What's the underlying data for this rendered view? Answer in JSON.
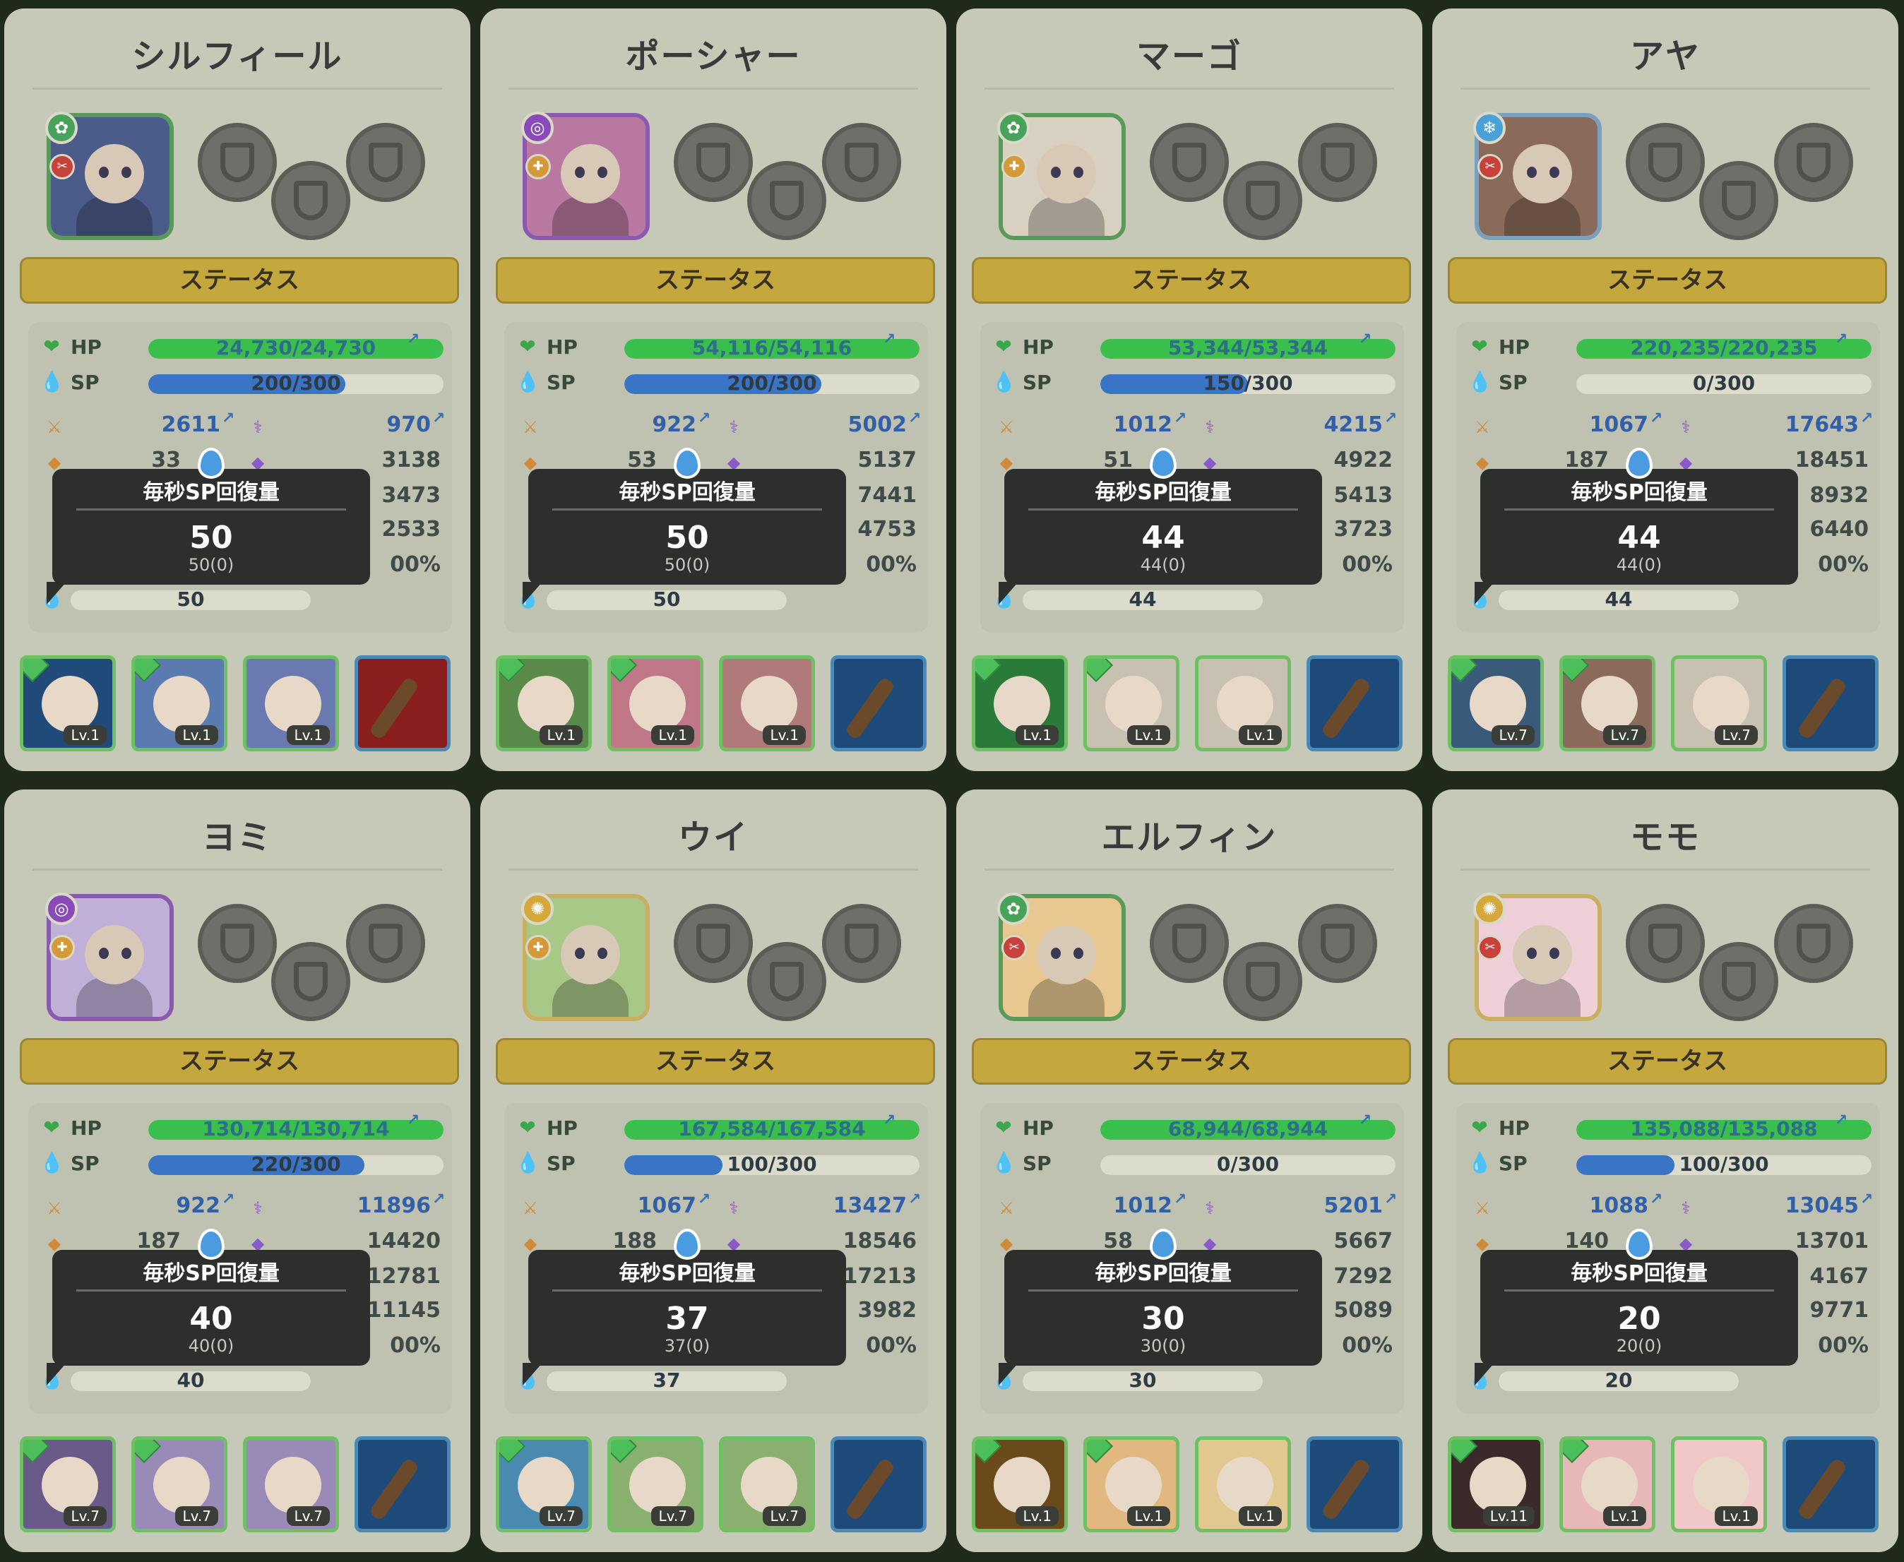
{
  "colors": {
    "hp_fill": "#3bbf4c",
    "sp_fill": "#3a74c4",
    "button": "#c4a73d",
    "card": "#c6c9b8",
    "tooltip": "#2d2f2c"
  },
  "tooltip_title": "毎秒SP回復量",
  "status_label": "ステータス",
  "hp_label": "HP",
  "sp_label": "SP",
  "characters": [
    {
      "name": "シルフィール",
      "element": "wind",
      "element_icon": "✿",
      "element_color": "#48a35a",
      "role_icon": "✂",
      "role_color": "#c8413a",
      "frame_color": "#5a9a58",
      "portrait_color": "#4b5b8a",
      "hp": "24,730/24,730",
      "hp_ratio": 1,
      "sp": "200/300",
      "sp_ratio": 0.667,
      "stat_atk": "2611",
      "stat_matk": "970",
      "stat_r2a": "33",
      "stat_r2b": "3138",
      "stat_r3b": "3473",
      "stat_r4b": "2533",
      "stat_r5b": "00%",
      "tt_value": "50",
      "tt_sub": "50(0)",
      "regen": "50",
      "skills": [
        {
          "lv": "Lv.1",
          "color": "#1f4a7a",
          "gem": true
        },
        {
          "lv": "Lv.1",
          "color": "#5b7bb0",
          "gem": true
        },
        {
          "lv": "Lv.1",
          "color": "#6a7ab0",
          "gem": false
        },
        {
          "lv": "",
          "color": "#8a1e1e",
          "gem": false
        }
      ]
    },
    {
      "name": "ポーシャー",
      "element": "dark",
      "element_icon": "◎",
      "element_color": "#8a4ab8",
      "role_icon": "✚",
      "role_color": "#d49a3a",
      "frame_color": "#8a5ab0",
      "portrait_color": "#b878a0",
      "hp": "54,116/54,116",
      "hp_ratio": 1,
      "sp": "200/300",
      "sp_ratio": 0.667,
      "stat_atk": "922",
      "stat_matk": "5002",
      "stat_r2a": "53",
      "stat_r2b": "5137",
      "stat_r3b": "7441",
      "stat_r4b": "4753",
      "stat_r5b": "00%",
      "tt_value": "50",
      "tt_sub": "50(0)",
      "regen": "50",
      "skills": [
        {
          "lv": "Lv.1",
          "color": "#5a8a4a",
          "gem": true
        },
        {
          "lv": "Lv.1",
          "color": "#c07888",
          "gem": true
        },
        {
          "lv": "Lv.1",
          "color": "#b07a7a",
          "gem": false
        },
        {
          "lv": "",
          "color": "#1e4a7a",
          "gem": false
        }
      ]
    },
    {
      "name": "マーゴ",
      "element": "wind",
      "element_icon": "✿",
      "element_color": "#48a35a",
      "role_icon": "✚",
      "role_color": "#d49a3a",
      "frame_color": "#5a9a58",
      "portrait_color": "#d8d0c0",
      "hp": "53,344/53,344",
      "hp_ratio": 1,
      "sp": "150/300",
      "sp_ratio": 0.5,
      "stat_atk": "1012",
      "stat_matk": "4215",
      "stat_r2a": "51",
      "stat_r2b": "4922",
      "stat_r3b": "5413",
      "stat_r4b": "3723",
      "stat_r5b": "00%",
      "tt_value": "44",
      "tt_sub": "44(0)",
      "regen": "44",
      "skills": [
        {
          "lv": "Lv.1",
          "color": "#2a7a3a",
          "gem": true
        },
        {
          "lv": "Lv.1",
          "color": "#c8c0b0",
          "gem": true
        },
        {
          "lv": "Lv.1",
          "color": "#c8c0b0",
          "gem": false
        },
        {
          "lv": "",
          "color": "#1e4a7a",
          "gem": false
        }
      ]
    },
    {
      "name": "アヤ",
      "element": "ice",
      "element_icon": "❄",
      "element_color": "#4aa0d8",
      "role_icon": "✂",
      "role_color": "#c8413a",
      "frame_color": "#7aa0c0",
      "portrait_color": "#8a6a5a",
      "hp": "220,235/220,235",
      "hp_ratio": 1,
      "sp": "0/300",
      "sp_ratio": 0,
      "stat_atk": "1067",
      "stat_matk": "17643",
      "stat_r2a": "187",
      "stat_r2b": "18451",
      "stat_r3b": "8932",
      "stat_r4b": "6440",
      "stat_r5b": "00%",
      "tt_value": "44",
      "tt_sub": "44(0)",
      "regen": "44",
      "skills": [
        {
          "lv": "Lv.7",
          "color": "#3a5a7a",
          "gem": true
        },
        {
          "lv": "Lv.7",
          "color": "#8a6a5a",
          "gem": true
        },
        {
          "lv": "Lv.7",
          "color": "#c8c0b0",
          "gem": false
        },
        {
          "lv": "",
          "color": "#1e4a7a",
          "gem": false
        }
      ]
    },
    {
      "name": "ヨミ",
      "element": "dark",
      "element_icon": "◎",
      "element_color": "#8a4ab8",
      "role_icon": "✚",
      "role_color": "#d49a3a",
      "frame_color": "#8a5ab0",
      "portrait_color": "#c0b0d8",
      "hp": "130,714/130,714",
      "hp_ratio": 1,
      "sp": "220/300",
      "sp_ratio": 0.733,
      "stat_atk": "922",
      "stat_matk": "11896",
      "stat_r2a": "187",
      "stat_r2b": "14420",
      "stat_r3b": "12781",
      "stat_r4b": "11145",
      "stat_r5b": "00%",
      "tt_value": "40",
      "tt_sub": "40(0)",
      "regen": "40",
      "skills": [
        {
          "lv": "Lv.7",
          "color": "#6a5a8a",
          "gem": true
        },
        {
          "lv": "Lv.7",
          "color": "#9a8ab8",
          "gem": true
        },
        {
          "lv": "Lv.7",
          "color": "#9a8ab8",
          "gem": false
        },
        {
          "lv": "",
          "color": "#1e4a7a",
          "gem": false
        }
      ]
    },
    {
      "name": "ウイ",
      "element": "light",
      "element_icon": "✺",
      "element_color": "#d4a83a",
      "role_icon": "✚",
      "role_color": "#d49a3a",
      "frame_color": "#c8b060",
      "portrait_color": "#a8c888",
      "hp": "167,584/167,584",
      "hp_ratio": 1,
      "sp": "100/300",
      "sp_ratio": 0.333,
      "stat_atk": "1067",
      "stat_matk": "13427",
      "stat_r2a": "188",
      "stat_r2b": "18546",
      "stat_r3b": "17213",
      "stat_r4b": "3982",
      "stat_r5b": "00%",
      "tt_value": "37",
      "tt_sub": "37(0)",
      "regen": "37",
      "skills": [
        {
          "lv": "Lv.7",
          "color": "#4a8ab0",
          "gem": true
        },
        {
          "lv": "Lv.7",
          "color": "#8ab070",
          "gem": true
        },
        {
          "lv": "Lv.7",
          "color": "#8ab070",
          "gem": false
        },
        {
          "lv": "",
          "color": "#1e4a7a",
          "gem": false
        }
      ]
    },
    {
      "name": "エルフィン",
      "element": "wind",
      "element_icon": "✿",
      "element_color": "#48a35a",
      "role_icon": "✂",
      "role_color": "#c8413a",
      "frame_color": "#5a9a58",
      "portrait_color": "#e8c890",
      "hp": "68,944/68,944",
      "hp_ratio": 1,
      "sp": "0/300",
      "sp_ratio": 0,
      "stat_atk": "1012",
      "stat_matk": "5201",
      "stat_r2a": "58",
      "stat_r2b": "5667",
      "stat_r3b": "7292",
      "stat_r4b": "5089",
      "stat_r5b": "00%",
      "tt_value": "30",
      "tt_sub": "30(0)",
      "regen": "30",
      "skills": [
        {
          "lv": "Lv.1",
          "color": "#6a4a1a",
          "gem": true
        },
        {
          "lv": "Lv.1",
          "color": "#e0b880",
          "gem": true
        },
        {
          "lv": "Lv.1",
          "color": "#e0c890",
          "gem": false
        },
        {
          "lv": "",
          "color": "#1e4a7a",
          "gem": false
        }
      ]
    },
    {
      "name": "モモ",
      "element": "light",
      "element_icon": "✺",
      "element_color": "#d4a83a",
      "role_icon": "✂",
      "role_color": "#c8413a",
      "frame_color": "#c8b060",
      "portrait_color": "#f0d0d8",
      "hp": "135,088/135,088",
      "hp_ratio": 1,
      "sp": "100/300",
      "sp_ratio": 0.333,
      "stat_atk": "1088",
      "stat_matk": "13045",
      "stat_r2a": "140",
      "stat_r2b": "13701",
      "stat_r3b": "4167",
      "stat_r4b": "9771",
      "stat_r5b": "00%",
      "tt_value": "20",
      "tt_sub": "20(0)",
      "regen": "20",
      "skills": [
        {
          "lv": "Lv.11",
          "color": "#3a2a2a",
          "gem": true
        },
        {
          "lv": "Lv.1",
          "color": "#e8b8b8",
          "gem": true
        },
        {
          "lv": "Lv.1",
          "color": "#f0c8c8",
          "gem": false
        },
        {
          "lv": "",
          "color": "#1e4a7a",
          "gem": false
        }
      ]
    }
  ]
}
